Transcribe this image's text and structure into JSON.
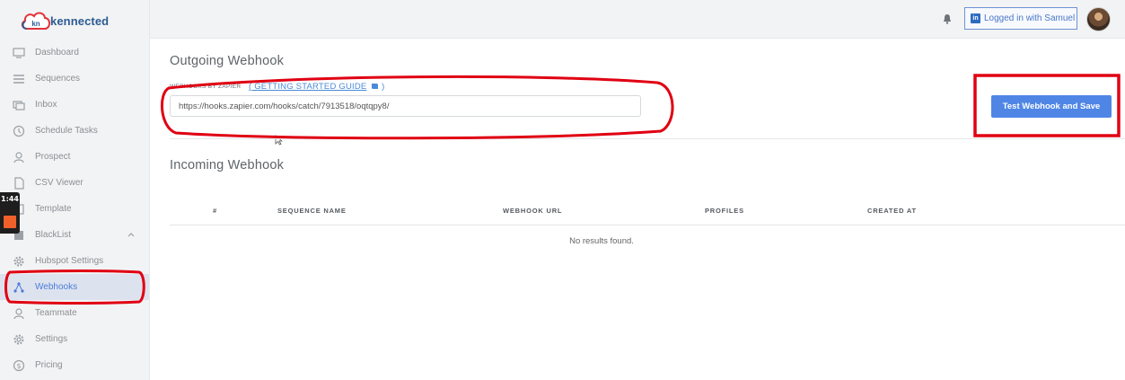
{
  "app": {
    "brand": "kennected",
    "logo_mark": "kn"
  },
  "sidebar": {
    "items": [
      {
        "label": "Dashboard",
        "icon": "monitor-icon"
      },
      {
        "label": "Sequences",
        "icon": "list-icon"
      },
      {
        "label": "Inbox",
        "icon": "inbox-icon"
      },
      {
        "label": "Schedule Tasks",
        "icon": "clock-icon"
      },
      {
        "label": "Prospect",
        "icon": "user-icon"
      },
      {
        "label": "CSV Viewer",
        "icon": "file-icon"
      },
      {
        "label": "Template",
        "icon": "template-icon"
      },
      {
        "label": "BlackList",
        "icon": "blacklist-icon"
      },
      {
        "label": "Hubspot Settings",
        "icon": "gear-icon"
      },
      {
        "label": "Webhooks",
        "icon": "webhook-icon",
        "active": true
      },
      {
        "label": "Teammate",
        "icon": "user-icon"
      },
      {
        "label": "Settings",
        "icon": "gear-icon"
      },
      {
        "label": "Pricing",
        "icon": "dollar-icon"
      }
    ]
  },
  "recorder": {
    "time": "1:44"
  },
  "header": {
    "login_label": "Logged in with Samuel",
    "linkedin_glyph": "in"
  },
  "outgoing": {
    "title": "Outgoing Webhook",
    "label": "WEBHOOKS BY ZAPIER",
    "guide_link": "( GETTING STARTED GUIDE",
    "guide_close": " )",
    "url_value": "https://hooks.zapier.com/hooks/catch/7913518/oqtqpy8/",
    "save_button": "Test Webhook and Save"
  },
  "incoming": {
    "title": "Incoming Webhook",
    "columns": [
      "#",
      "SEQUENCE NAME",
      "WEBHOOK URL",
      "PROFILES",
      "CREATED AT"
    ],
    "empty_text": "No results found."
  },
  "colors": {
    "accent": "#4f86e6",
    "annotation": "#e00012",
    "sidebar_bg": "#f2f3f4"
  }
}
